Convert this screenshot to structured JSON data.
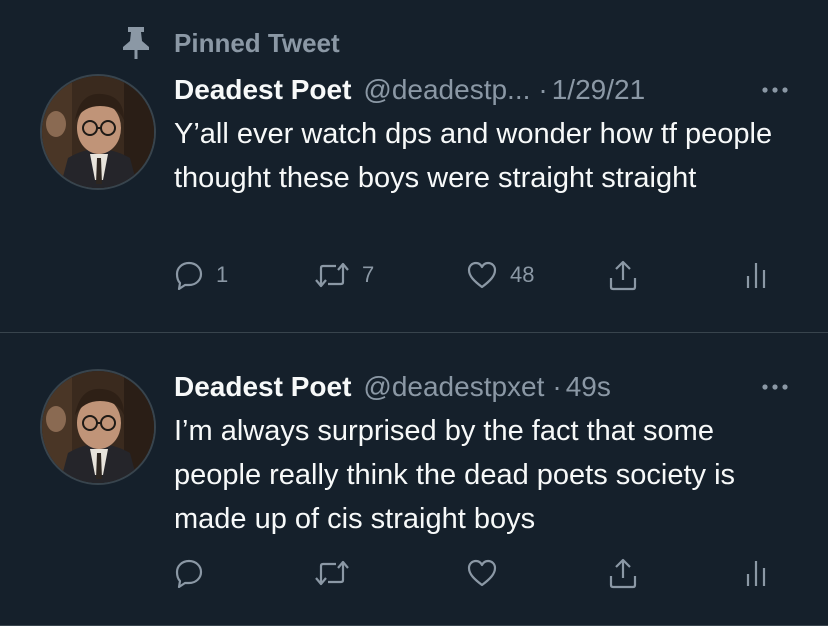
{
  "pinned_label": "Pinned Tweet",
  "colors": {
    "background": "#15202b",
    "text": "#f7f9f9",
    "secondary": "#8b98a5",
    "divider": "#38444d"
  },
  "tweets": [
    {
      "display_name": "Deadest Poet",
      "handle": "@deadestp...",
      "separator": "·",
      "time": "1/29/21",
      "text": "Y’all ever watch dps and wonder how tf people thought these boys were straight straight",
      "replies": "1",
      "retweets": "7",
      "likes": "48"
    },
    {
      "display_name": "Deadest Poet",
      "handle": "@deadestpxet",
      "separator": "·",
      "time": "49s",
      "text": "I’m always surprised by the fact that some people really think the dead poets society is made up of cis straight boys",
      "replies": "",
      "retweets": "",
      "likes": ""
    }
  ]
}
